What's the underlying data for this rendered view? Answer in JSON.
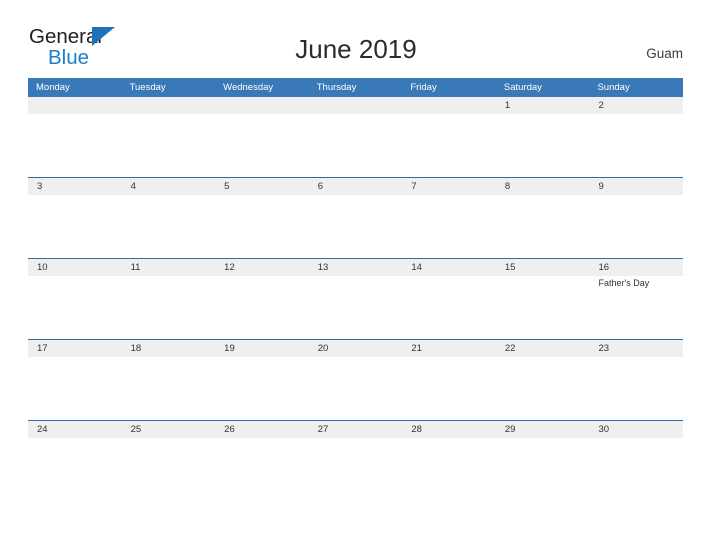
{
  "brand": {
    "name_part1": "General",
    "name_part2": "Blue",
    "flag_icon": "blue-triangle-flag",
    "color_dark": "#231f20",
    "color_blue": "#1c7fc9"
  },
  "header": {
    "title": "June 2019",
    "location": "Guam"
  },
  "calendar": {
    "accent_color": "#3a79b8",
    "date_strip_color": "#efefef",
    "weekdays": [
      "Monday",
      "Tuesday",
      "Wednesday",
      "Thursday",
      "Friday",
      "Saturday",
      "Sunday"
    ],
    "weeks": [
      {
        "days": [
          {
            "date": "",
            "events": []
          },
          {
            "date": "",
            "events": []
          },
          {
            "date": "",
            "events": []
          },
          {
            "date": "",
            "events": []
          },
          {
            "date": "",
            "events": []
          },
          {
            "date": "1",
            "events": []
          },
          {
            "date": "2",
            "events": []
          }
        ]
      },
      {
        "days": [
          {
            "date": "3",
            "events": []
          },
          {
            "date": "4",
            "events": []
          },
          {
            "date": "5",
            "events": []
          },
          {
            "date": "6",
            "events": []
          },
          {
            "date": "7",
            "events": []
          },
          {
            "date": "8",
            "events": []
          },
          {
            "date": "9",
            "events": []
          }
        ]
      },
      {
        "days": [
          {
            "date": "10",
            "events": []
          },
          {
            "date": "11",
            "events": []
          },
          {
            "date": "12",
            "events": []
          },
          {
            "date": "13",
            "events": []
          },
          {
            "date": "14",
            "events": []
          },
          {
            "date": "15",
            "events": []
          },
          {
            "date": "16",
            "events": [
              "Father's Day"
            ]
          }
        ]
      },
      {
        "days": [
          {
            "date": "17",
            "events": []
          },
          {
            "date": "18",
            "events": []
          },
          {
            "date": "19",
            "events": []
          },
          {
            "date": "20",
            "events": []
          },
          {
            "date": "21",
            "events": []
          },
          {
            "date": "22",
            "events": []
          },
          {
            "date": "23",
            "events": []
          }
        ]
      },
      {
        "days": [
          {
            "date": "24",
            "events": []
          },
          {
            "date": "25",
            "events": []
          },
          {
            "date": "26",
            "events": []
          },
          {
            "date": "27",
            "events": []
          },
          {
            "date": "28",
            "events": []
          },
          {
            "date": "29",
            "events": []
          },
          {
            "date": "30",
            "events": []
          }
        ]
      }
    ]
  }
}
